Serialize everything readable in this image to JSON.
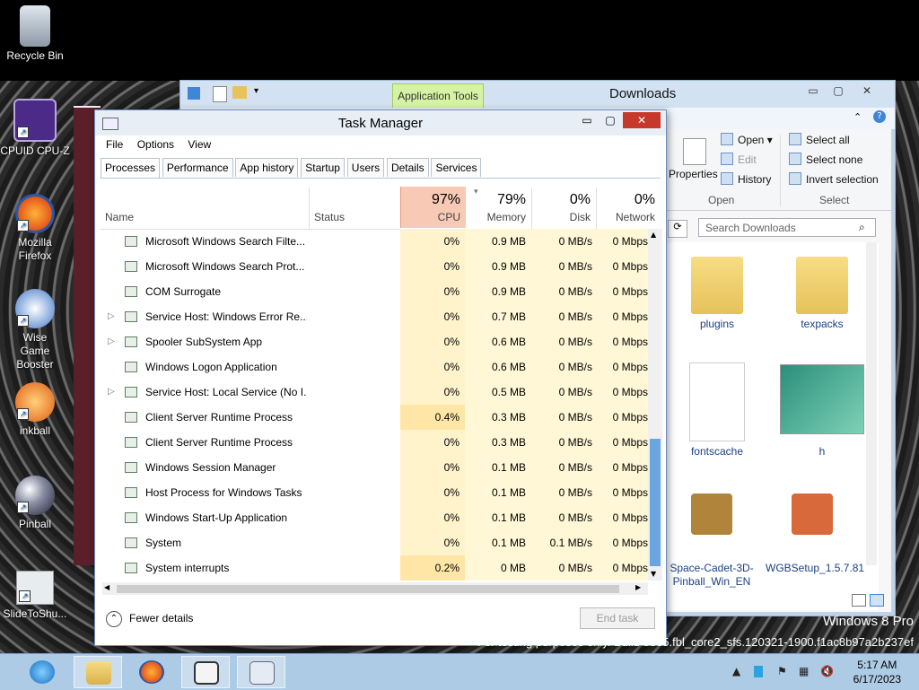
{
  "desktop": {
    "icons": [
      {
        "label": "Recycle Bin"
      },
      {
        "label": "CPUID CPU-Z"
      },
      {
        "label": "Mozilla Firefox"
      },
      {
        "label": "Wise Game Booster"
      },
      {
        "label": "inkball"
      },
      {
        "label": "Pinball"
      },
      {
        "label": "SlideToShu..."
      }
    ],
    "watermark_line1": "Windows 8 Pro",
    "watermark_line2": "For testing purposes only. Build 8365.fbl_core2_sfs.120321-1900.f1ac8b97a2b237ef"
  },
  "explorer": {
    "title": "Downloads",
    "context_tab": "Application Tools",
    "ribbon": {
      "properties": "Properties",
      "open": "Open",
      "edit": "Edit",
      "history": "History",
      "open_group": "Open",
      "select_all": "Select all",
      "select_none": "Select none",
      "invert_selection": "Invert selection",
      "select_group": "Select"
    },
    "search_placeholder": "Search Downloads",
    "files": [
      {
        "name": "plugins"
      },
      {
        "name": "texpacks"
      },
      {
        "name": "fontscache"
      },
      {
        "name": "h"
      },
      {
        "name": "Space-Cadet-3D-Pinball_Win_EN"
      },
      {
        "name": "WGBSetup_1.5.7.81"
      }
    ]
  },
  "task_manager": {
    "title": "Task Manager",
    "menu": [
      "File",
      "Options",
      "View"
    ],
    "tabs": [
      "Processes",
      "Performance",
      "App history",
      "Startup",
      "Users",
      "Details",
      "Services"
    ],
    "active_tab": "Processes",
    "columns": {
      "name": "Name",
      "status": "Status",
      "cpu_pct": "97%",
      "cpu": "CPU",
      "mem_pct": "79%",
      "mem": "Memory",
      "disk_pct": "0%",
      "disk": "Disk",
      "net_pct": "0%",
      "net": "Network"
    },
    "rows": [
      {
        "name": "Microsoft Windows Search Filte...",
        "cpu": "0%",
        "mem": "0.9 MB",
        "disk": "0 MB/s",
        "net": "0 Mbps",
        "expand": ""
      },
      {
        "name": "Microsoft Windows Search Prot...",
        "cpu": "0%",
        "mem": "0.9 MB",
        "disk": "0 MB/s",
        "net": "0 Mbps",
        "expand": ""
      },
      {
        "name": "COM Surrogate",
        "cpu": "0%",
        "mem": "0.9 MB",
        "disk": "0 MB/s",
        "net": "0 Mbps",
        "expand": ""
      },
      {
        "name": "Service Host: Windows Error Re...",
        "cpu": "0%",
        "mem": "0.7 MB",
        "disk": "0 MB/s",
        "net": "0 Mbps",
        "expand": "▷"
      },
      {
        "name": "Spooler SubSystem App",
        "cpu": "0%",
        "mem": "0.6 MB",
        "disk": "0 MB/s",
        "net": "0 Mbps",
        "expand": "▷"
      },
      {
        "name": "Windows Logon Application",
        "cpu": "0%",
        "mem": "0.6 MB",
        "disk": "0 MB/s",
        "net": "0 Mbps",
        "expand": ""
      },
      {
        "name": "Service Host: Local Service (No I...",
        "cpu": "0%",
        "mem": "0.5 MB",
        "disk": "0 MB/s",
        "net": "0 Mbps",
        "expand": "▷"
      },
      {
        "name": "Client Server Runtime Process",
        "cpu": "0.4%",
        "mem": "0.3 MB",
        "disk": "0 MB/s",
        "net": "0 Mbps",
        "expand": ""
      },
      {
        "name": "Client Server Runtime Process",
        "cpu": "0%",
        "mem": "0.3 MB",
        "disk": "0 MB/s",
        "net": "0 Mbps",
        "expand": ""
      },
      {
        "name": "Windows Session Manager",
        "cpu": "0%",
        "mem": "0.1 MB",
        "disk": "0 MB/s",
        "net": "0 Mbps",
        "expand": ""
      },
      {
        "name": "Host Process for Windows Tasks",
        "cpu": "0%",
        "mem": "0.1 MB",
        "disk": "0 MB/s",
        "net": "0 Mbps",
        "expand": ""
      },
      {
        "name": "Windows Start-Up Application",
        "cpu": "0%",
        "mem": "0.1 MB",
        "disk": "0 MB/s",
        "net": "0 Mbps",
        "expand": ""
      },
      {
        "name": "System",
        "cpu": "0%",
        "mem": "0.1 MB",
        "disk": "0.1 MB/s",
        "net": "0 Mbps",
        "expand": ""
      },
      {
        "name": "System interrupts",
        "cpu": "0.2%",
        "mem": "0 MB",
        "disk": "0 MB/s",
        "net": "0 Mbps",
        "expand": ""
      }
    ],
    "fewer_details": "Fewer details",
    "end_task": "End task"
  },
  "taskbar": {
    "time": "5:17 AM",
    "date": "6/17/2023"
  },
  "colors": {
    "cpu_header": "#f8c9b4",
    "cpu_column": "#fff3cc",
    "scroll_thumb": "#6aa5e0",
    "taskbar": "#aecbe6"
  }
}
